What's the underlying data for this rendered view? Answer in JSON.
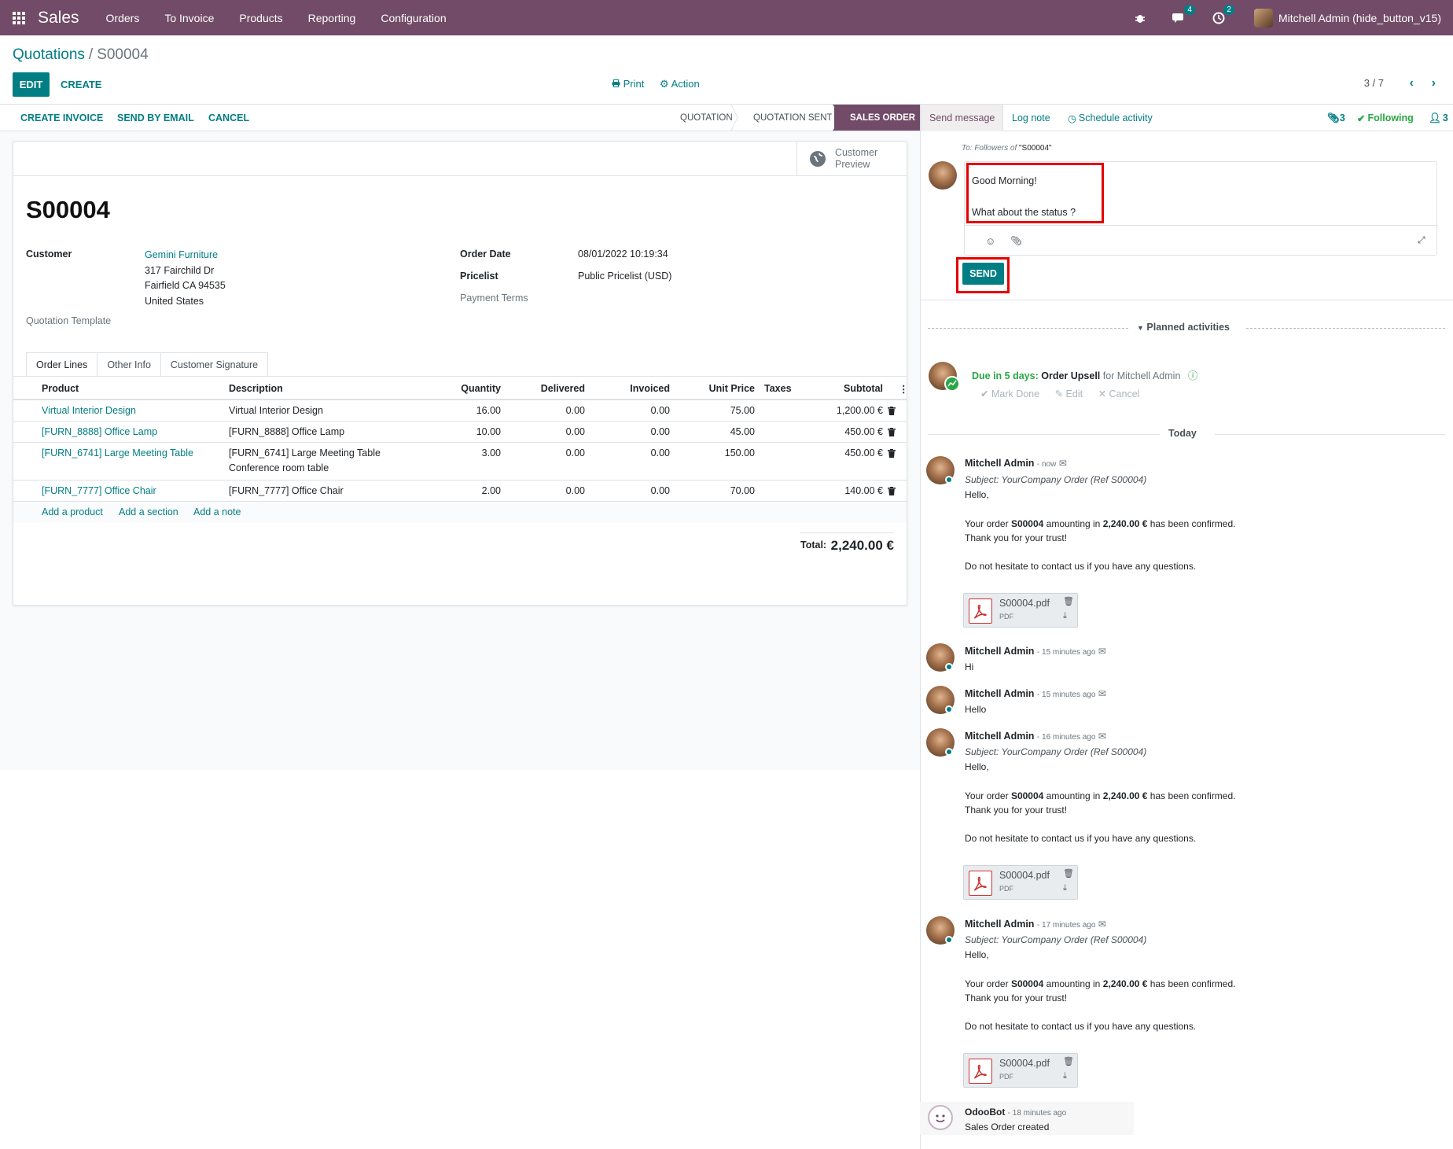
{
  "navbar": {
    "app_name": "Sales",
    "menus": [
      "Orders",
      "To Invoice",
      "Products",
      "Reporting",
      "Configuration"
    ],
    "messages_count": "4",
    "activities_count": "2",
    "user_name": "Mitchell Admin (hide_button_v15)",
    "icons": [
      "apps-grid-icon",
      "bug-icon",
      "chat-icon",
      "clock-icon"
    ]
  },
  "control_panel": {
    "breadcrumb_parent": "Quotations",
    "breadcrumb_sep": "/",
    "breadcrumb_current": "S00004",
    "edit_label": "EDIT",
    "create_label": "CREATE",
    "print_label": "Print",
    "action_label": "Action",
    "pager": "3 / 7"
  },
  "statusbar": {
    "buttons": [
      "CREATE INVOICE",
      "SEND BY EMAIL",
      "CANCEL"
    ],
    "stages": [
      "QUOTATION",
      "QUOTATION SENT",
      "SALES ORDER"
    ],
    "active_stage": "SALES ORDER"
  },
  "form": {
    "customer_preview_line1": "Customer",
    "customer_preview_line2": "Preview",
    "name": "S00004",
    "customer_label": "Customer",
    "customer_name": "Gemini Furniture",
    "address_line1": "317 Fairchild Dr",
    "address_line2": "Fairfield CA 94535",
    "address_line3": "United States",
    "quotation_template_label": "Quotation Template",
    "order_date_label": "Order Date",
    "order_date": "08/01/2022 10:19:34",
    "pricelist_label": "Pricelist",
    "pricelist": "Public Pricelist (USD)",
    "payment_terms_label": "Payment Terms",
    "tabs": [
      "Order Lines",
      "Other Info",
      "Customer Signature"
    ],
    "columns": [
      "Product",
      "Description",
      "Quantity",
      "Delivered",
      "Invoiced",
      "Unit Price",
      "Taxes",
      "Subtotal"
    ],
    "lines": [
      {
        "product": "Virtual Interior Design",
        "description": "Virtual Interior Design",
        "description2": "",
        "quantity": "16.00",
        "delivered": "0.00",
        "invoiced": "0.00",
        "unit_price": "75.00",
        "subtotal": "1,200.00 €"
      },
      {
        "product": "[FURN_8888] Office Lamp",
        "description": "[FURN_8888] Office Lamp",
        "description2": "",
        "quantity": "10.00",
        "delivered": "0.00",
        "invoiced": "0.00",
        "unit_price": "45.00",
        "subtotal": "450.00 €"
      },
      {
        "product": "[FURN_6741] Large Meeting Table",
        "description": "[FURN_6741] Large Meeting Table",
        "description2": "Conference room table",
        "quantity": "3.00",
        "delivered": "0.00",
        "invoiced": "0.00",
        "unit_price": "150.00",
        "subtotal": "450.00 €"
      },
      {
        "product": "[FURN_7777] Office Chair",
        "description": "[FURN_7777] Office Chair",
        "description2": "",
        "quantity": "2.00",
        "delivered": "0.00",
        "invoiced": "0.00",
        "unit_price": "70.00",
        "subtotal": "140.00 €"
      }
    ],
    "add_product": "Add a product",
    "add_section": "Add a section",
    "add_note": "Add a note",
    "total_label": "Total:",
    "total_value": "2,240.00 €"
  },
  "chatter": {
    "send_message": "Send message",
    "log_note": "Log note",
    "schedule_activity": "Schedule activity",
    "attachments_count": "3",
    "following": "Following",
    "followers_count": "3",
    "to_prefix": "To:",
    "to_followers": "Followers of",
    "to_record": "\"S00004\"",
    "composer_line1": "Good Morning!",
    "composer_line2": "What about the status ?",
    "send_label": "SEND",
    "planned_activities": "Planned activities",
    "activity_due": "Due in 5 days:",
    "activity_summary": "Order Upsell",
    "activity_for": "for Mitchell Admin",
    "mark_done": "Mark Done",
    "edit": "Edit",
    "cancel": "Cancel",
    "today": "Today",
    "messages": [
      {
        "author": "Mitchell Admin",
        "date": "- now",
        "subject": "Subject: YourCompany Order (Ref S00004)",
        "hello": "Hello,",
        "body_pre": "Your order ",
        "body_ref": "S00004",
        "body_mid": " amounting in ",
        "body_amount": "2,240.00 €",
        "body_post": " has been confirmed.",
        "thanks": "Thank you for your trust!",
        "contact": "Do not hesitate to contact us if you have any questions.",
        "attachment": "S00004.pdf",
        "attachment_type": "PDF"
      },
      {
        "author": "Mitchell Admin",
        "date": "- 15 minutes ago",
        "text": "Hi"
      },
      {
        "author": "Mitchell Admin",
        "date": "- 15 minutes ago",
        "text": "Hello"
      },
      {
        "author": "Mitchell Admin",
        "date": "- 16 minutes ago",
        "subject": "Subject: YourCompany Order (Ref S00004)",
        "hello": "Hello,",
        "body_pre": "Your order ",
        "body_ref": "S00004",
        "body_mid": " amounting in ",
        "body_amount": "2,240.00 €",
        "body_post": " has been confirmed.",
        "thanks": "Thank you for your trust!",
        "contact": "Do not hesitate to contact us if you have any questions.",
        "attachment": "S00004.pdf",
        "attachment_type": "PDF"
      },
      {
        "author": "Mitchell Admin",
        "date": "- 17 minutes ago",
        "subject": "Subject: YourCompany Order (Ref S00004)",
        "hello": "Hello,",
        "body_pre": "Your order ",
        "body_ref": "S00004",
        "body_mid": " amounting in ",
        "body_amount": "2,240.00 €",
        "body_post": " has been confirmed.",
        "thanks": "Thank you for your trust!",
        "contact": "Do not hesitate to contact us if you have any questions.",
        "attachment": "S00004.pdf",
        "attachment_type": "PDF"
      },
      {
        "author": "OdooBot",
        "date": "- 18 minutes ago",
        "text": "Sales Order created"
      }
    ]
  },
  "colors": {
    "brand": "#714b67",
    "accent": "#017e84",
    "highlight": "#e60000",
    "success": "#28a745"
  }
}
